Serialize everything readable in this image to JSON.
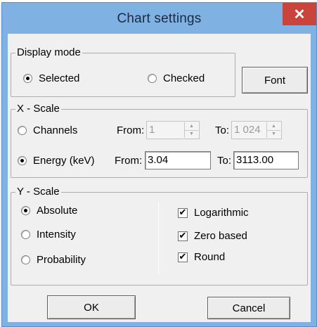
{
  "dialog": {
    "title": "Chart settings",
    "close_glyph": "✕"
  },
  "display_mode": {
    "legend": "Display mode",
    "options": [
      {
        "label": "Selected",
        "checked": true
      },
      {
        "label": "Checked",
        "checked": false
      }
    ],
    "font_button": "Font"
  },
  "x_scale": {
    "legend": "X - Scale",
    "channels": {
      "label": "Channels",
      "checked": false,
      "from_label": "From:",
      "from_value": "1",
      "to_label": "To:",
      "to_value": "1 024"
    },
    "energy": {
      "label": "Energy (keV)",
      "checked": true,
      "from_label": "From:",
      "from_value": "3.04",
      "to_label": "To:",
      "to_value": "3113.00"
    }
  },
  "y_scale": {
    "legend": "Y - Scale",
    "options": [
      {
        "label": "Absolute",
        "checked": true
      },
      {
        "label": "Intensity",
        "checked": false
      },
      {
        "label": "Probability",
        "checked": false
      }
    ],
    "checks": [
      {
        "label": "Logarithmic",
        "checked": true
      },
      {
        "label": "Zero based",
        "checked": true
      },
      {
        "label": "Round",
        "checked": true
      }
    ]
  },
  "buttons": {
    "ok": "OK",
    "cancel": "Cancel"
  },
  "icons": {
    "check_mark": "✔",
    "spin_up": "▲",
    "spin_down": "▼"
  }
}
